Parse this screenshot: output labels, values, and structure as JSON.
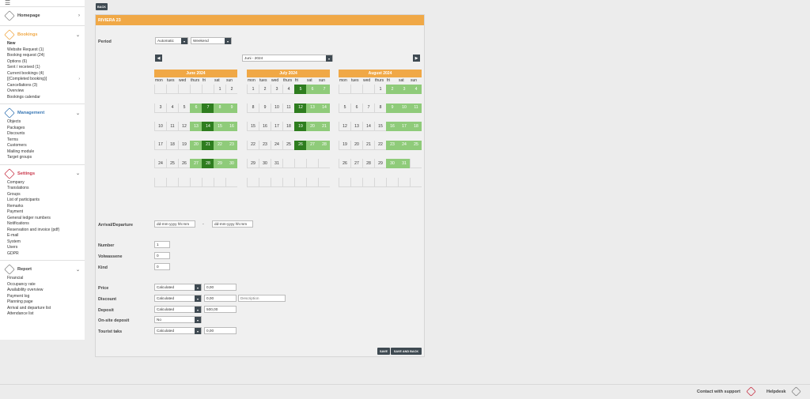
{
  "sidebar": {
    "menu_glyph": "☰",
    "sections": [
      {
        "title": "Homepage",
        "icon": "home-icon",
        "items": []
      },
      {
        "title": "Bookings",
        "icon": "calendar-icon",
        "items": [
          "New",
          "Website Request (1)",
          "Booking request (24)",
          "Options (6)",
          "Sent / received (1)",
          "Current bookings (4)",
          "[(Completed booking)]",
          "Cancellations (3)",
          "Overview",
          "Bookings calendar"
        ]
      },
      {
        "title": "Management",
        "icon": "grid-icon",
        "items": [
          "Objects",
          "Packages",
          "Discounts",
          "Terms",
          "Customers",
          "Mailing module",
          "Target groups"
        ]
      },
      {
        "title": "Settings",
        "icon": "gear-icon",
        "items": [
          "Company",
          "Translations",
          "Groups",
          "List of participants",
          "Remarks",
          "Payment",
          "General ledger numbers",
          "Notifications",
          "Reservation and invoice (pdf)",
          "E-mail",
          "System",
          "Users",
          "GDPR"
        ]
      },
      {
        "title": "Report",
        "icon": "report-icon",
        "items": [
          "Financial",
          "Occupancy rate",
          "Availability overview",
          "Payment log",
          "Planning page",
          "Arrival and departure list",
          "Attendance list"
        ]
      }
    ]
  },
  "back_label": "BACK",
  "panel_title": "RIVIERA 23",
  "period": {
    "label": "Period",
    "mode": "Automatic",
    "type": "Weekend"
  },
  "month_select": "Juni - 2024",
  "nav": {
    "prev": "◀",
    "next": "▶"
  },
  "weekdays": [
    "mon",
    "tues",
    "wed",
    "thurs",
    "fri",
    "sat",
    "sun"
  ],
  "months": [
    {
      "title": "June 2024",
      "offset": 5,
      "days": 30,
      "light": [
        6,
        8,
        9,
        13,
        15,
        16,
        20,
        22,
        23,
        27,
        29,
        30
      ],
      "dark": [
        7,
        14,
        21,
        28
      ]
    },
    {
      "title": "July 2024",
      "offset": 0,
      "days": 31,
      "light": [
        6,
        7,
        13,
        14,
        20,
        21,
        27,
        28
      ],
      "dark": [
        5,
        12,
        19,
        26
      ]
    },
    {
      "title": "August 2024",
      "offset": 3,
      "days": 31,
      "light": [
        2,
        3,
        4,
        9,
        10,
        11,
        16,
        17,
        18,
        23,
        24,
        25,
        30,
        31
      ],
      "dark": []
    }
  ],
  "arrival": {
    "label": "Arrival/Departure",
    "placeholder_from": "dd-mm-yyyy hh:mm",
    "separator": "-",
    "placeholder_to": "dd-mm-yyyy hh:mm"
  },
  "counts": [
    {
      "label": "Number",
      "value": "1"
    },
    {
      "label": "Volwassene",
      "value": "0"
    },
    {
      "label": "Kind",
      "value": "0"
    }
  ],
  "pricing": {
    "price": {
      "label": "Price",
      "mode": "Calculated",
      "value": "0,00"
    },
    "discount": {
      "label": "Discount",
      "mode": "Calculated",
      "value": "0,00",
      "desc_placeholder": "Description"
    },
    "deposit": {
      "label": "Deposit",
      "mode": "Calculated",
      "value": "500,00"
    },
    "onsite": {
      "label": "On-site deposit",
      "mode": "No"
    },
    "tourist": {
      "label": "Tourist taks",
      "mode": "Calculated",
      "value": "0,00"
    }
  },
  "buttons": {
    "save": "SAVE",
    "save_back": "SAVE AND BACK"
  },
  "footer": {
    "support": "Contact with support",
    "helpdesk": "Helpdesk"
  },
  "colors": {
    "accent": "#f0a846",
    "light_green": "#8fcb7a",
    "dark_green": "#2e7d1f",
    "button": "#3f4a52"
  }
}
